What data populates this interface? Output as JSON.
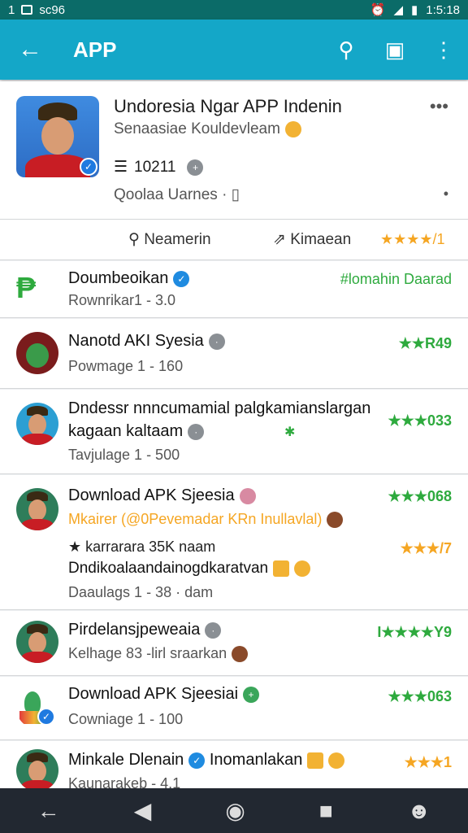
{
  "status_bar": {
    "left_text": "1",
    "center_text": "sc96",
    "time": "1:5:18"
  },
  "app_bar": {
    "title": "APP"
  },
  "top_card": {
    "title": "Undoresia Ngar APP Indenin",
    "subtitle": "Senaasiae Kouldevleam",
    "id": "10211",
    "q": "Qoolaa Uarnes"
  },
  "actions": {
    "a1": "Neamerin",
    "a2": "Kimaean",
    "stars": "★★★★/1"
  },
  "items": [
    {
      "title": "Doumbeoikan",
      "sub": "Rownrikar1 - 3.0",
      "right": "#lomahin Daarad"
    },
    {
      "title": "Nanotd AKI Syesia",
      "sub": "Powmage 1 - 160",
      "right": "★★R49"
    },
    {
      "title": "Dndessr nnncumamial palgkamianslargan",
      "title2": "kagaan kaltaam",
      "sub": "Tavjulage 1 - 500",
      "right": "★★★033"
    },
    {
      "title": "Download APK Sjeesia",
      "sub": "Mkairer (@0Pevemadar KRn Inullavlal)",
      "sub2": "★ karrarara 35K naam",
      "sub3": "Dndikoalaandainogdkaratvan",
      "sub4": "Daaulags 1 - 38 · dam",
      "right": "★★★068",
      "right2": "★★★/7"
    },
    {
      "title": "Pirdelansjpeweaia",
      "sub": "Kelhage 83 -lirl sraarkan",
      "right": "I★★★★Y9"
    },
    {
      "title": "Download APK Sjeesiai",
      "sub": "Cowniage 1 - 100",
      "right": "★★★063"
    },
    {
      "title": "Minkale Dlenain",
      "title_extra": "Inomanlakan",
      "sub": "Kaunarakeb - 4.1",
      "right": "★★★1"
    }
  ],
  "colors": {
    "primary": "#14a7c8",
    "status": "#0b6b68",
    "rating_green": "#2eaa3e",
    "rating_orange": "#f5a623"
  },
  "icons": [
    "back-arrow-icon",
    "search-icon",
    "cart-icon",
    "more-vert-icon",
    "nav-back-icon",
    "nav-home-icon",
    "nav-recents-icon"
  ]
}
